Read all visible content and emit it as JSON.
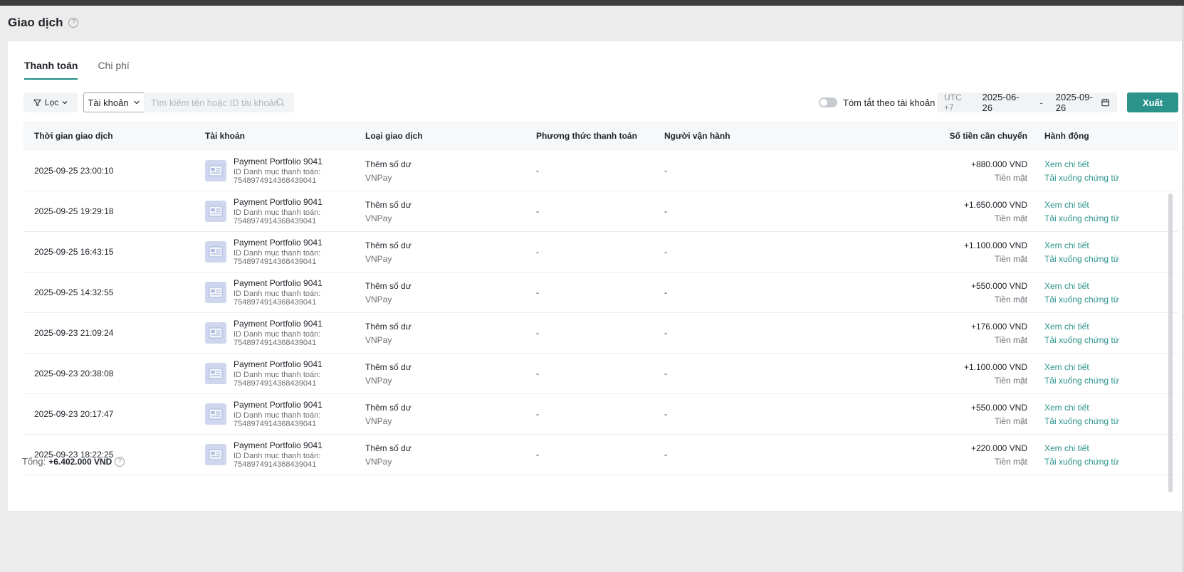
{
  "page": {
    "title": "Giao dịch",
    "help": "?"
  },
  "tabs": [
    {
      "label": "Thanh toán",
      "active": true
    },
    {
      "label": "Chi phí",
      "active": false
    }
  ],
  "toolbar": {
    "filter_label": "Lọc",
    "account_select": "Tài khoản",
    "search_placeholder": "Tìm kiếm tên hoặc ID tài khoản",
    "summary_toggle_label": "Tóm tắt theo tài khoản",
    "timezone": "UTC +7",
    "date_from": "2025-06-26",
    "date_sep": "-",
    "date_to": "2025-09-26",
    "export_label": "Xuất"
  },
  "table": {
    "columns": [
      "Thời gian giao dịch",
      "Tài khoản",
      "Loại giao dịch",
      "Phương thức thanh toán",
      "Người vận hành",
      "Số tiền cần chuyển",
      "Hành động"
    ],
    "rows": [
      {
        "time": "2025-09-25 23:00:10",
        "account": "Payment Portfolio 9041",
        "account_id_label": "ID Danh mục thanh toán:",
        "account_id": "7548974914368439041",
        "type": "Thêm số dư",
        "type_sub": "VNPay",
        "method": "-",
        "operator": "-",
        "amount": "+880.000 VND",
        "amount_sub": "Tiền mặt",
        "action_view": "Xem chi tiết",
        "action_download": "Tải xuống chứng từ"
      },
      {
        "time": "2025-09-25 19:29:18",
        "account": "Payment Portfolio 9041",
        "account_id_label": "ID Danh mục thanh toán:",
        "account_id": "7548974914368439041",
        "type": "Thêm số dư",
        "type_sub": "VNPay",
        "method": "-",
        "operator": "-",
        "amount": "+1.650.000 VND",
        "amount_sub": "Tiền mặt",
        "action_view": "Xem chi tiết",
        "action_download": "Tải xuống chứng từ"
      },
      {
        "time": "2025-09-25 16:43:15",
        "account": "Payment Portfolio 9041",
        "account_id_label": "ID Danh mục thanh toán:",
        "account_id": "7548974914368439041",
        "type": "Thêm số dư",
        "type_sub": "VNPay",
        "method": "-",
        "operator": "-",
        "amount": "+1.100.000 VND",
        "amount_sub": "Tiền mặt",
        "action_view": "Xem chi tiết",
        "action_download": "Tải xuống chứng từ"
      },
      {
        "time": "2025-09-25 14:32:55",
        "account": "Payment Portfolio 9041",
        "account_id_label": "ID Danh mục thanh toán:",
        "account_id": "7548974914368439041",
        "type": "Thêm số dư",
        "type_sub": "VNPay",
        "method": "-",
        "operator": "-",
        "amount": "+550.000 VND",
        "amount_sub": "Tiền mặt",
        "action_view": "Xem chi tiết",
        "action_download": "Tải xuống chứng từ"
      },
      {
        "time": "2025-09-23 21:09:24",
        "account": "Payment Portfolio 9041",
        "account_id_label": "ID Danh mục thanh toán:",
        "account_id": "7548974914368439041",
        "type": "Thêm số dư",
        "type_sub": "VNPay",
        "method": "-",
        "operator": "-",
        "amount": "+176.000 VND",
        "amount_sub": "Tiền mặt",
        "action_view": "Xem chi tiết",
        "action_download": "Tải xuống chứng từ"
      },
      {
        "time": "2025-09-23 20:38:08",
        "account": "Payment Portfolio 9041",
        "account_id_label": "ID Danh mục thanh toán:",
        "account_id": "7548974914368439041",
        "type": "Thêm số dư",
        "type_sub": "VNPay",
        "method": "-",
        "operator": "-",
        "amount": "+1.100.000 VND",
        "amount_sub": "Tiền mặt",
        "action_view": "Xem chi tiết",
        "action_download": "Tải xuống chứng từ"
      },
      {
        "time": "2025-09-23 20:17:47",
        "account": "Payment Portfolio 9041",
        "account_id_label": "ID Danh mục thanh toán:",
        "account_id": "7548974914368439041",
        "type": "Thêm số dư",
        "type_sub": "VNPay",
        "method": "-",
        "operator": "-",
        "amount": "+550.000 VND",
        "amount_sub": "Tiền mặt",
        "action_view": "Xem chi tiết",
        "action_download": "Tải xuống chứng từ"
      },
      {
        "time": "2025-09-23 18:22:25",
        "account": "Payment Portfolio 9041",
        "account_id_label": "ID Danh mục thanh toán:",
        "account_id": "7548974914368439041",
        "type": "Thêm số dư",
        "type_sub": "VNPay",
        "method": "-",
        "operator": "-",
        "amount": "+220.000 VND",
        "amount_sub": "Tiền mặt",
        "action_view": "Xem chi tiết",
        "action_download": "Tải xuống chứng từ"
      }
    ]
  },
  "footer": {
    "total_label": "Tổng:",
    "total_value": "+6.402.000 VND"
  },
  "colors": {
    "accent": "#2b938b",
    "top_bar": "#3d3d3d",
    "background": "#ececec"
  },
  "icons": [
    "help-circle-icon",
    "filter-icon",
    "chevron-down-icon",
    "search-icon",
    "calendar-icon",
    "account-card-icon"
  ]
}
